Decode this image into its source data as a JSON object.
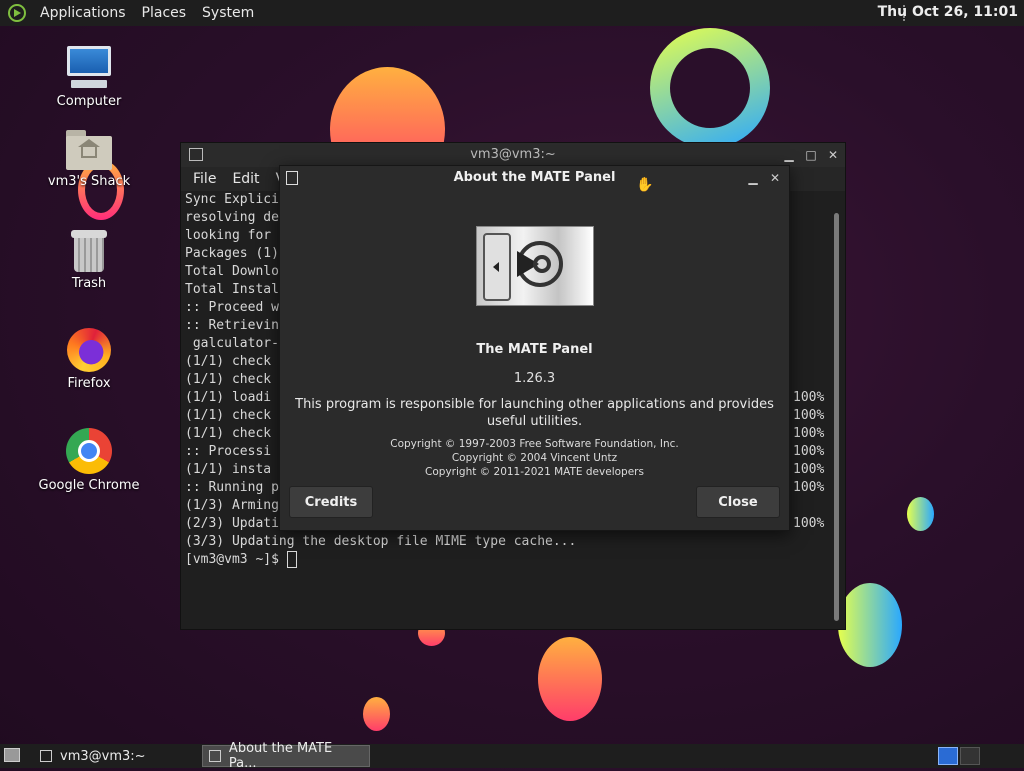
{
  "top_panel": {
    "menus": [
      "Applications",
      "Places",
      "System"
    ],
    "clock": "Thu Oct 26, 11:01"
  },
  "desktop_icons": [
    {
      "label": "Computer",
      "icon": "computer-icon"
    },
    {
      "label": "vm3's Shack",
      "icon": "home-folder-icon"
    },
    {
      "label": "Trash",
      "icon": "trash-icon"
    },
    {
      "label": "Firefox",
      "icon": "firefox-icon"
    },
    {
      "label": "Google Chrome",
      "icon": "chrome-icon"
    }
  ],
  "terminal": {
    "title": "vm3@vm3:~",
    "menu": [
      "File",
      "Edit",
      "V"
    ],
    "lines": [
      "Sync Explicit",
      "resolving de",
      "looking for",
      "",
      "Packages (1)",
      "",
      "Total Downlo",
      "Total Instal",
      "",
      ":: Proceed w",
      ":: Retrievin",
      " galculator-",
      "(1/1) check",
      "(1/1) check",
      "(1/1) loadi",
      "(1/1) check",
      "(1/1) check",
      ":: Processi",
      "(1/1) insta",
      ":: Running post-transaction hooks...",
      "(1/3) Arming ConditionNeedsUpdate...",
      "(2/3) Updating icon theme caches...",
      "(3/3) Updating the desktop file MIME type cache...",
      "[vm3@vm3 ~]$ "
    ],
    "percent_column": [
      "100%",
      "100%",
      "100%",
      "100%",
      "100%",
      "100%",
      "",
      "100%"
    ]
  },
  "about_dialog": {
    "title": "About the MATE Panel",
    "program_name": "The MATE Panel",
    "version": "1.26.3",
    "description": "This program is responsible for launching other applications and provides useful utilities.",
    "copyright": [
      "Copyright © 1997-2003 Free Software Foundation, Inc.",
      "Copyright © 2004 Vincent Untz",
      "Copyright © 2011-2021 MATE developers"
    ],
    "credits_label": "Credits",
    "close_label": "Close"
  },
  "taskbar": {
    "tasks": [
      {
        "label": "vm3@vm3:~",
        "active": false
      },
      {
        "label": "About the MATE Pa...",
        "active": true
      }
    ]
  },
  "colors": {
    "panel": "#1e1e1e",
    "dialog": "#2b2b2b",
    "workspace_active": "#2a6bd4"
  }
}
